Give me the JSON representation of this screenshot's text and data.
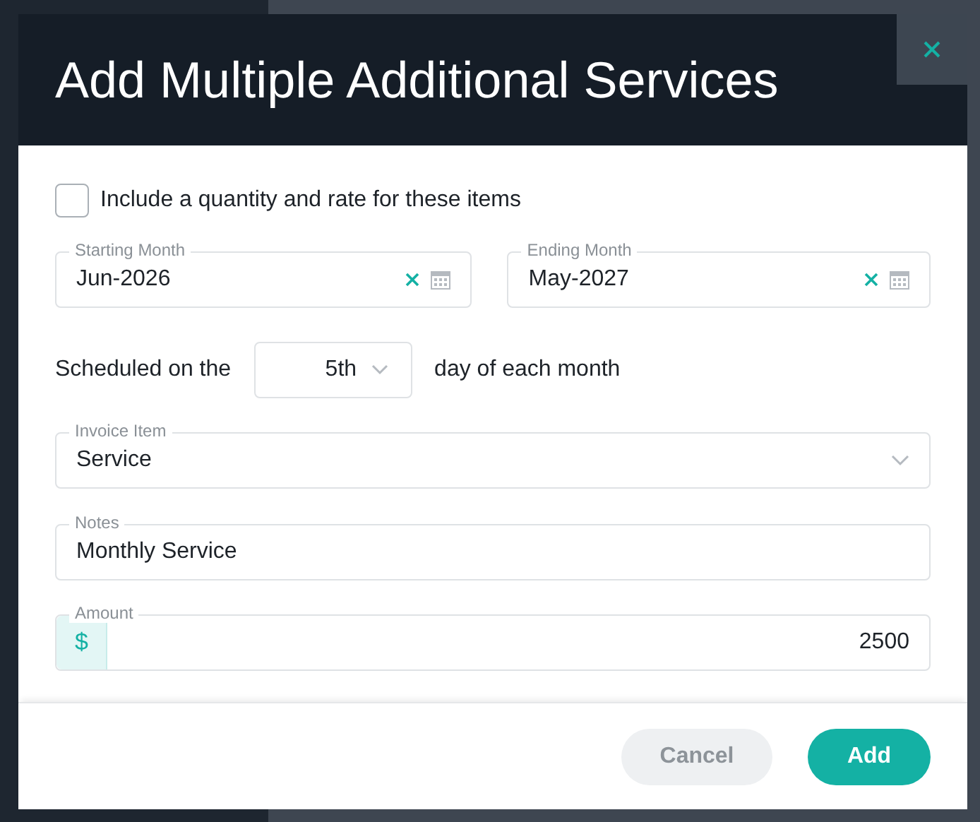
{
  "dialog": {
    "title": "Add Multiple Additional Services"
  },
  "include_quantity": {
    "label": "Include a quantity and rate for these items",
    "checked": false
  },
  "date_fields": [
    {
      "label": "Starting Month",
      "value": "Jun-2026"
    },
    {
      "label": "Ending Month",
      "value": "May-2027"
    }
  ],
  "schedule": {
    "prefix": "Scheduled on the",
    "day": "5th",
    "suffix": "day of each month"
  },
  "invoice_item": {
    "label": "Invoice Item",
    "value": "Service"
  },
  "notes": {
    "label": "Notes",
    "value": "Monthly Service"
  },
  "amount": {
    "label": "Amount",
    "prefix": "$",
    "value": "2500"
  },
  "buttons": [
    {
      "label": "Cancel",
      "kind": "secondary"
    },
    {
      "label": "Add",
      "kind": "primary"
    }
  ]
}
